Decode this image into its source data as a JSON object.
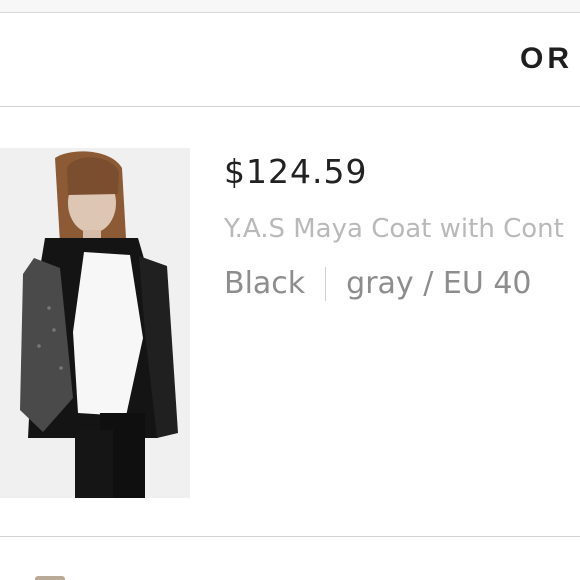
{
  "header": {
    "title": "OR"
  },
  "order_item": {
    "price": "$124.59",
    "product_name": "Y.A.S Maya Coat with Cont",
    "color": "Black",
    "size": "gray / EU 40",
    "image_icon": "product-photo"
  }
}
